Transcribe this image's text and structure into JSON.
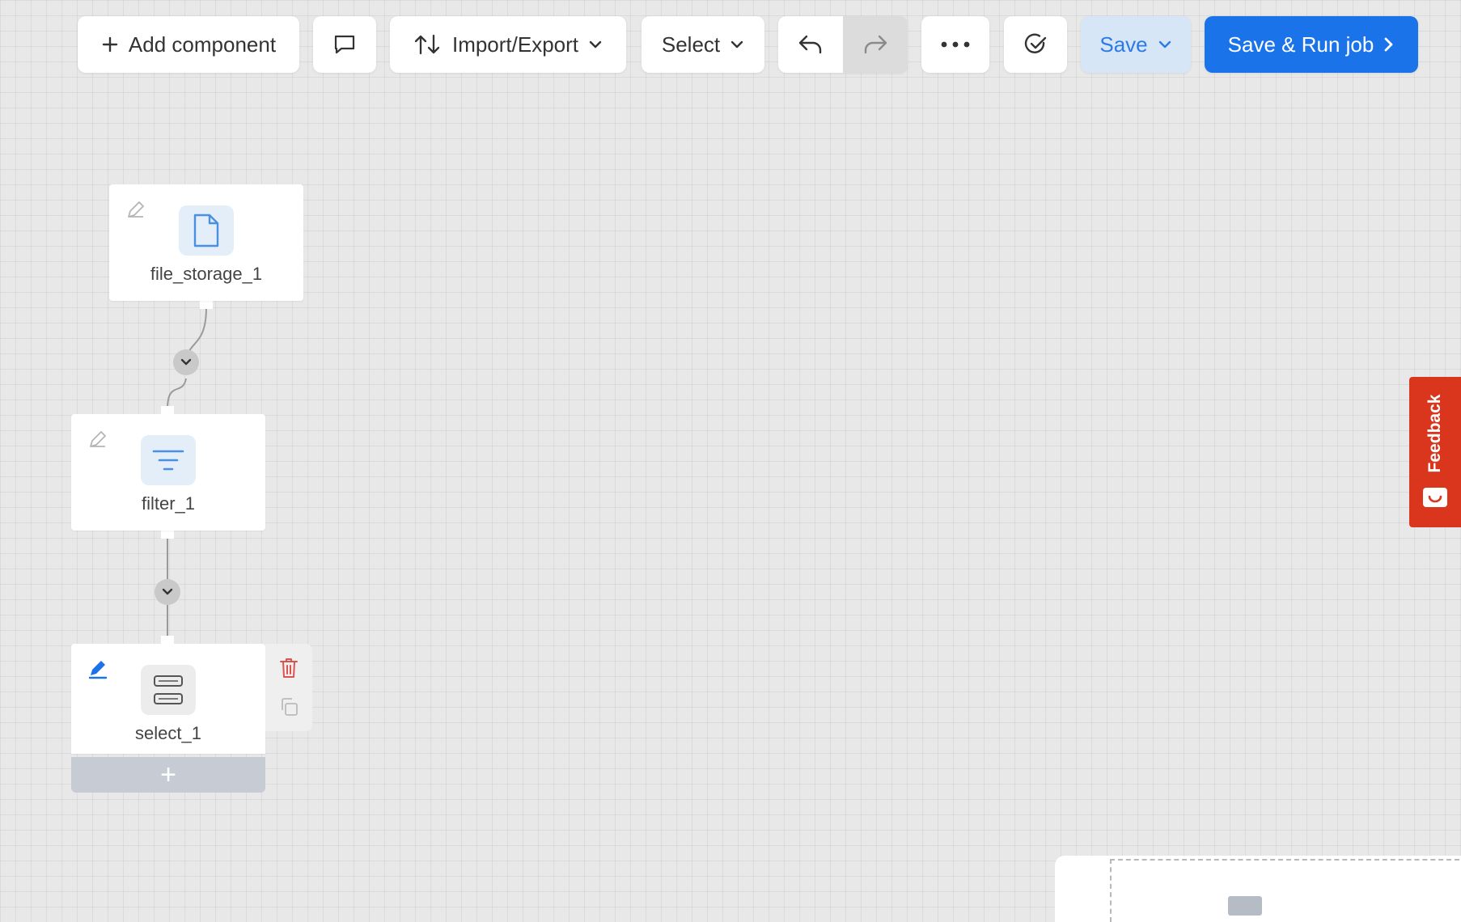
{
  "toolbar": {
    "add_component": "Add component",
    "import_export": "Import/Export",
    "select": "Select",
    "save": "Save",
    "save_run": "Save & Run job"
  },
  "nodes": [
    {
      "label": "file_storage_1",
      "icon": "file-icon"
    },
    {
      "label": "filter_1",
      "icon": "filter-icon"
    },
    {
      "label": "select_1",
      "icon": "select-columns-icon"
    }
  ],
  "add_bar": "+",
  "feedback": "Feedback",
  "colors": {
    "accent": "#1a73e8",
    "save_bg": "#d6e6f7",
    "feedback": "#d9361d",
    "delete": "#d9534f"
  }
}
